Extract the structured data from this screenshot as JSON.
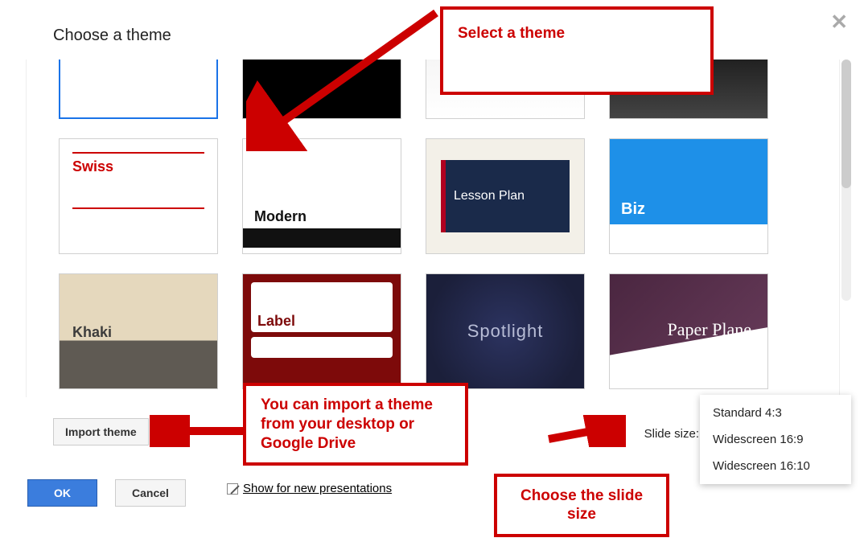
{
  "title": "Choose a theme",
  "close_label": "✕",
  "themes": {
    "swiss": "Swiss",
    "modern": "Modern",
    "lesson": "Lesson Plan",
    "biz": "Biz",
    "khaki": "Khaki",
    "label": "Label",
    "spotlight": "Spotlight",
    "paperplane": "Paper Plane"
  },
  "import_button": "Import theme",
  "slide_size_label": "Slide size:",
  "size_options": {
    "opt1": "Standard 4:3",
    "opt2": "Widescreen 16:9",
    "opt3": "Widescreen 16:10"
  },
  "checkbox_label": "Show for new presentations",
  "ok_label": "OK",
  "cancel_label": "Cancel",
  "annotations": {
    "select_theme": "Select a theme",
    "import_theme": "You can import a theme from your desktop or Google Drive",
    "choose_size": "Choose the slide size"
  }
}
